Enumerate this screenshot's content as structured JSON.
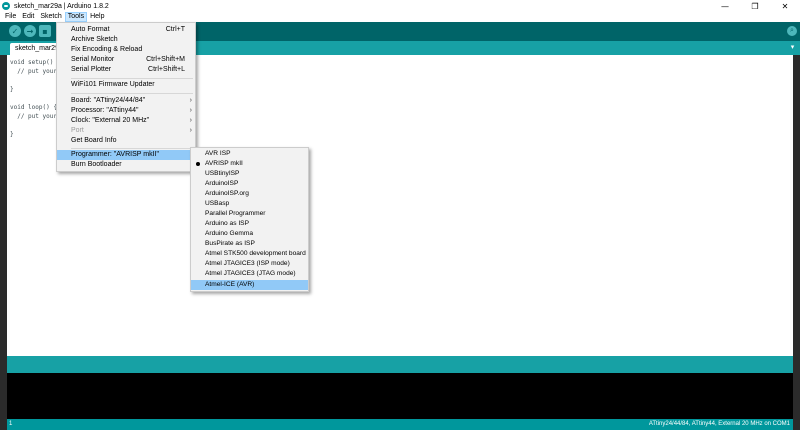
{
  "window": {
    "title": "sketch_mar29a | Arduino 1.8.2",
    "minimize": "—",
    "maximize": "❐",
    "close": "✕"
  },
  "menubar": {
    "items": [
      "File",
      "Edit",
      "Sketch",
      "Tools",
      "Help"
    ]
  },
  "toolbar": {
    "verify": "✓",
    "upload": "→",
    "new": "▪",
    "serial_monitor": "⌕"
  },
  "tabs": {
    "active": "sketch_mar29a",
    "menu_arrow": "▾"
  },
  "editor": {
    "lines": [
      "void setup() {",
      "  // put your",
      "",
      "}",
      "",
      "void loop() {",
      "  // put your",
      "",
      "}"
    ]
  },
  "tools_menu": {
    "items": [
      {
        "label": "Auto Format",
        "shortcut": "Ctrl+T"
      },
      {
        "label": "Archive Sketch",
        "shortcut": ""
      },
      {
        "label": "Fix Encoding & Reload",
        "shortcut": ""
      },
      {
        "label": "Serial Monitor",
        "shortcut": "Ctrl+Shift+M"
      },
      {
        "label": "Serial Plotter",
        "shortcut": "Ctrl+Shift+L"
      },
      {
        "label": "WiFi101 Firmware Updater",
        "shortcut": ""
      },
      {
        "label": "Board: \"ATtiny24/44/84\"",
        "submenu": true
      },
      {
        "label": "Processor: \"ATtiny44\"",
        "submenu": true
      },
      {
        "label": "Clock: \"External 20 MHz\"",
        "submenu": true
      },
      {
        "label": "Port",
        "submenu": true,
        "disabled": true
      },
      {
        "label": "Get Board Info"
      },
      {
        "label": "Programmer: \"AVRISP mkII\"",
        "submenu": true,
        "highlighted": true
      },
      {
        "label": "Burn Bootloader"
      }
    ]
  },
  "programmer_menu": {
    "selected": "AVRISP mkII",
    "items": [
      "AVR ISP",
      "AVRISP mkII",
      "USBtinyISP",
      "ArduinoISP",
      "ArduinoISP.org",
      "USBasp",
      "Parallel Programmer",
      "Arduino as ISP",
      "Arduino Gemma",
      "BusPirate as ISP",
      "Atmel STK500 development board",
      "Atmel JTAGICE3 (ISP mode)",
      "Atmel JTAGICE3 (JTAG mode)",
      "Atmel-ICE (AVR)"
    ],
    "hovered": "Atmel-ICE (AVR)"
  },
  "status": {
    "line_number": "1",
    "board_info": "ATtiny24/44/84, ATtiny44, External 20 MHz on COM1"
  },
  "colors": {
    "toolbar": "#006468",
    "tabstrip": "#17a1a5",
    "highlight": "#91c9f7"
  }
}
